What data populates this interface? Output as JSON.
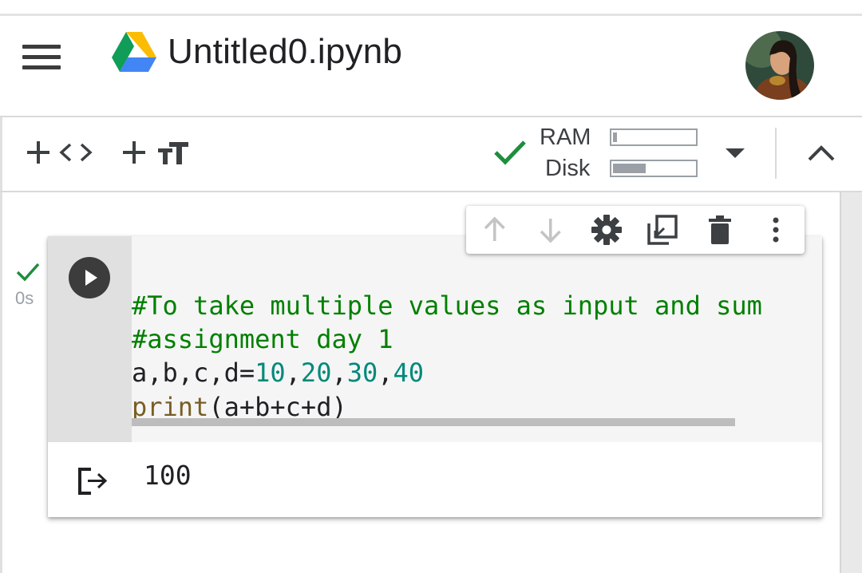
{
  "header": {
    "title": "Untitled0.ipynb"
  },
  "toolbar": {
    "resources": {
      "ram_label": "RAM",
      "disk_label": "Disk",
      "ram_usage": 0.05,
      "disk_usage": 0.4,
      "status": "connected"
    }
  },
  "cell": {
    "exec_time": "0s",
    "code_lines": [
      "#To take multiple values as input and sum",
      "#assignment day 1",
      "a,b,c,d=10,20,30,40",
      "print(a+b+c+d)"
    ],
    "code_tokens": {
      "line3_vars": "a,b,c,d=",
      "n1": "10",
      "c1": ",",
      "n2": "20",
      "c2": ",",
      "n3": "30",
      "c3": ",",
      "n4": "40",
      "line4_fn": "print",
      "line4_args": "(a+b+c+d)"
    },
    "output": "100"
  },
  "colors": {
    "check_green": "#1e8e3e",
    "comment_green": "#008000",
    "number_teal": "#00897b",
    "builtin_brown": "#795e26"
  }
}
